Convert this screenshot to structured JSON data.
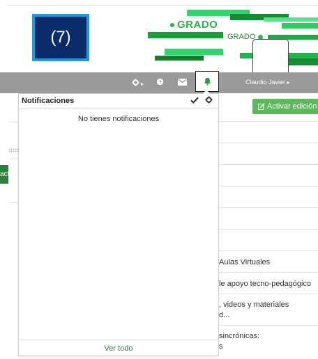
{
  "banner": {
    "badge_text": "(7)",
    "grado_large": "GRADO",
    "grado_small": "GRADO",
    "colors": {
      "green": "#29b34a",
      "badge_bg": "#0a2a6a",
      "badge_border": "#1a9be0"
    }
  },
  "navbar": {
    "icons": [
      "gear-icon",
      "clock-icon",
      "envelope-icon",
      "bell-icon"
    ],
    "user_name": "Claudio Javier",
    "user_caret": "▸",
    "gear_caret": "▸"
  },
  "page": {
    "activar_icon": "edit-icon",
    "activar_label": "Activar edición",
    "left_button_fragment": "acti",
    "right_items": [
      "Aulas Virtuales",
      "le apoyo tecno-pedagógico",
      ", videos y materiales",
      "d...",
      "sincrónicas:",
      "s"
    ]
  },
  "notifications": {
    "title": "Notificaciones",
    "mark_read_icon": "check-icon",
    "settings_icon": "gear-icon",
    "empty_text": "No tienes notificaciones",
    "footer_link": "Ver todo"
  }
}
